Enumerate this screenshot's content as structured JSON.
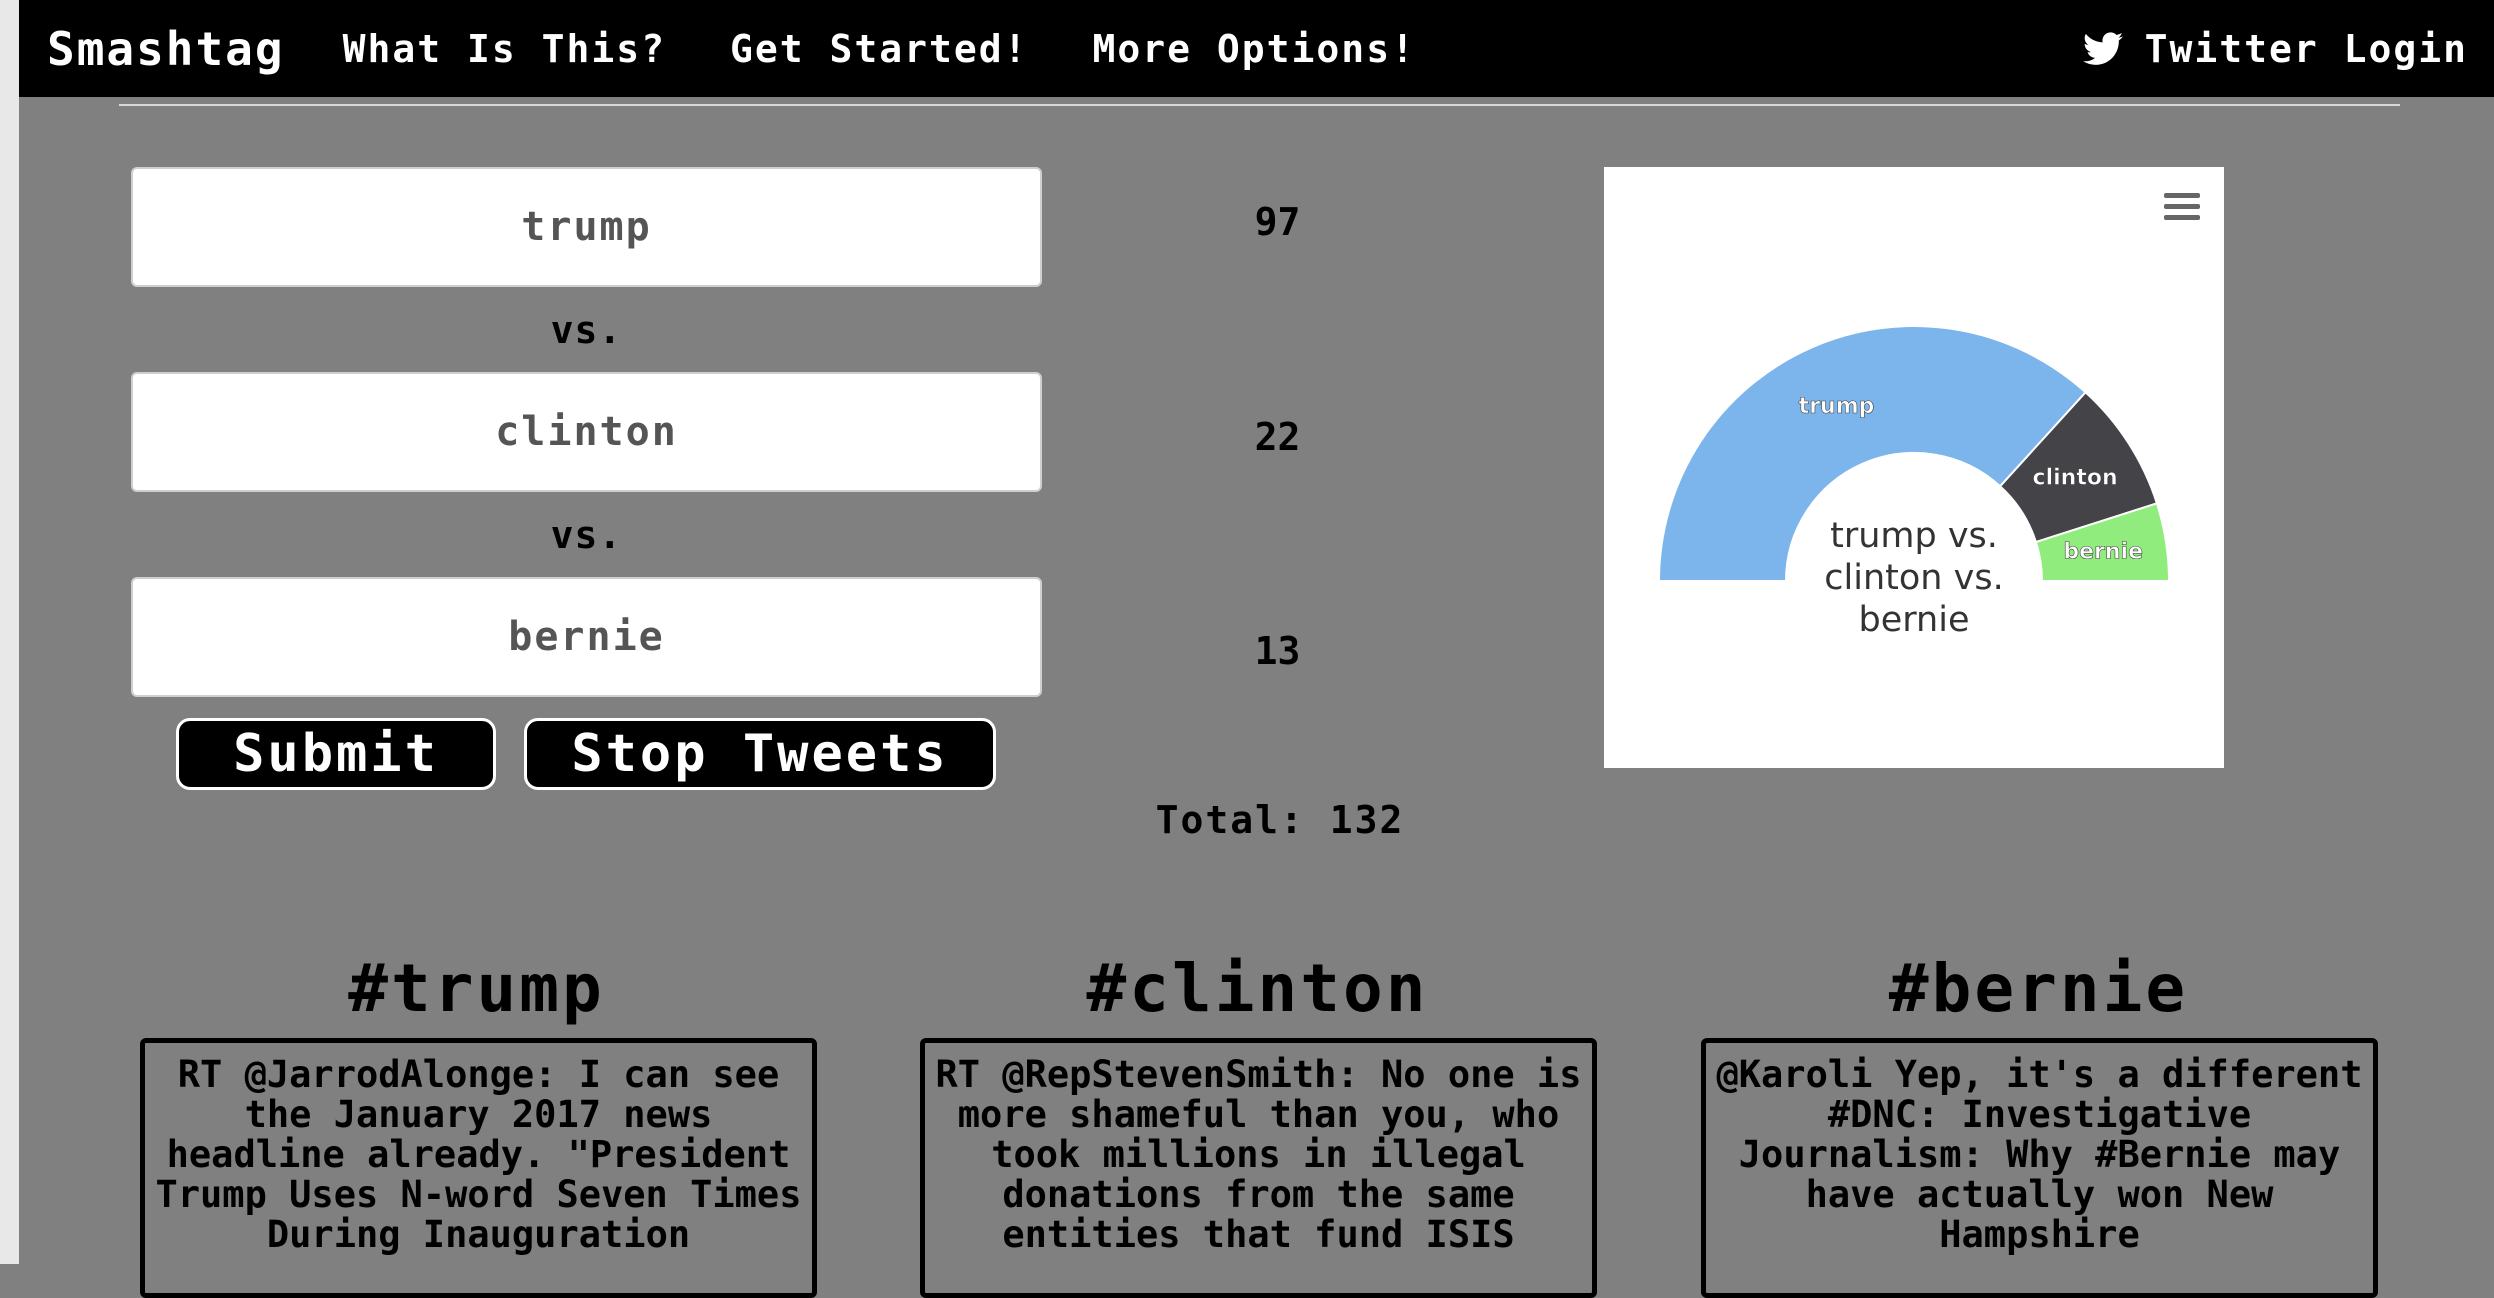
{
  "navbar": {
    "brand": "Smashtag",
    "links": [
      "What Is This?",
      "Get Started!",
      "More Options!"
    ],
    "login": "Twitter Login"
  },
  "form": {
    "inputs": [
      "trump",
      "clinton",
      "bernie"
    ],
    "vs_label": "vs.",
    "submit_label": "Submit",
    "stop_label": "Stop Tweets"
  },
  "counts": [
    "97",
    "22",
    "13"
  ],
  "total_label": "Total:",
  "total_value": "132",
  "chart_data": {
    "type": "pie",
    "title": "trump vs. clinton vs. bernie",
    "categories": [
      "trump",
      "clinton",
      "bernie"
    ],
    "values": [
      97,
      22,
      13
    ],
    "colors": [
      "#7cb5ec",
      "#434348",
      "#90ed7d"
    ]
  },
  "columns": [
    {
      "title": "#trump",
      "tweet": "RT @JarrodAlonge: I can see the January 2017 news headline already. \"President Trump Uses N-word Seven Times During Inauguration"
    },
    {
      "title": "#clinton",
      "tweet": "RT @RepStevenSmith: No one is more shameful than you, who took millions in illegal donations from the same entities that fund ISIS"
    },
    {
      "title": "#bernie",
      "tweet": "@Karoli Yep, it's a different #DNC: Investigative Journalism: Why #Bernie may have actually won New Hampshire"
    }
  ]
}
